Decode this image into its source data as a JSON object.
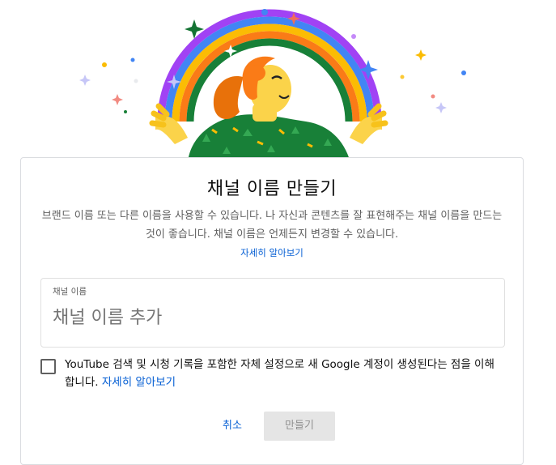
{
  "dialog": {
    "title": "채널 이름 만들기",
    "description": "브랜드 이름 또는 다른 이름을 사용할 수 있습니다. 나 자신과 콘텐츠를 잘 표현해주는 채널 이름을 만드는 것이 좋습니다. 채널 이름은 언제든지 변경할 수 있습니다.",
    "learn_more": "자세히 알아보기",
    "field": {
      "label": "채널 이름",
      "placeholder": "채널 이름 추가",
      "value": ""
    },
    "consent": {
      "text": "YouTube 검색 및 시청 기록을 포함한 자체 설정으로 새 Google 계정이 생성된다는 점을 이해합니다.",
      "link": "자세히 알아보기",
      "checked": false
    },
    "buttons": {
      "cancel": "취소",
      "create": "만들기"
    }
  },
  "colors": {
    "accent": "#065fd4",
    "text_secondary": "#606060",
    "disabled_bg": "#e5e5e5"
  }
}
